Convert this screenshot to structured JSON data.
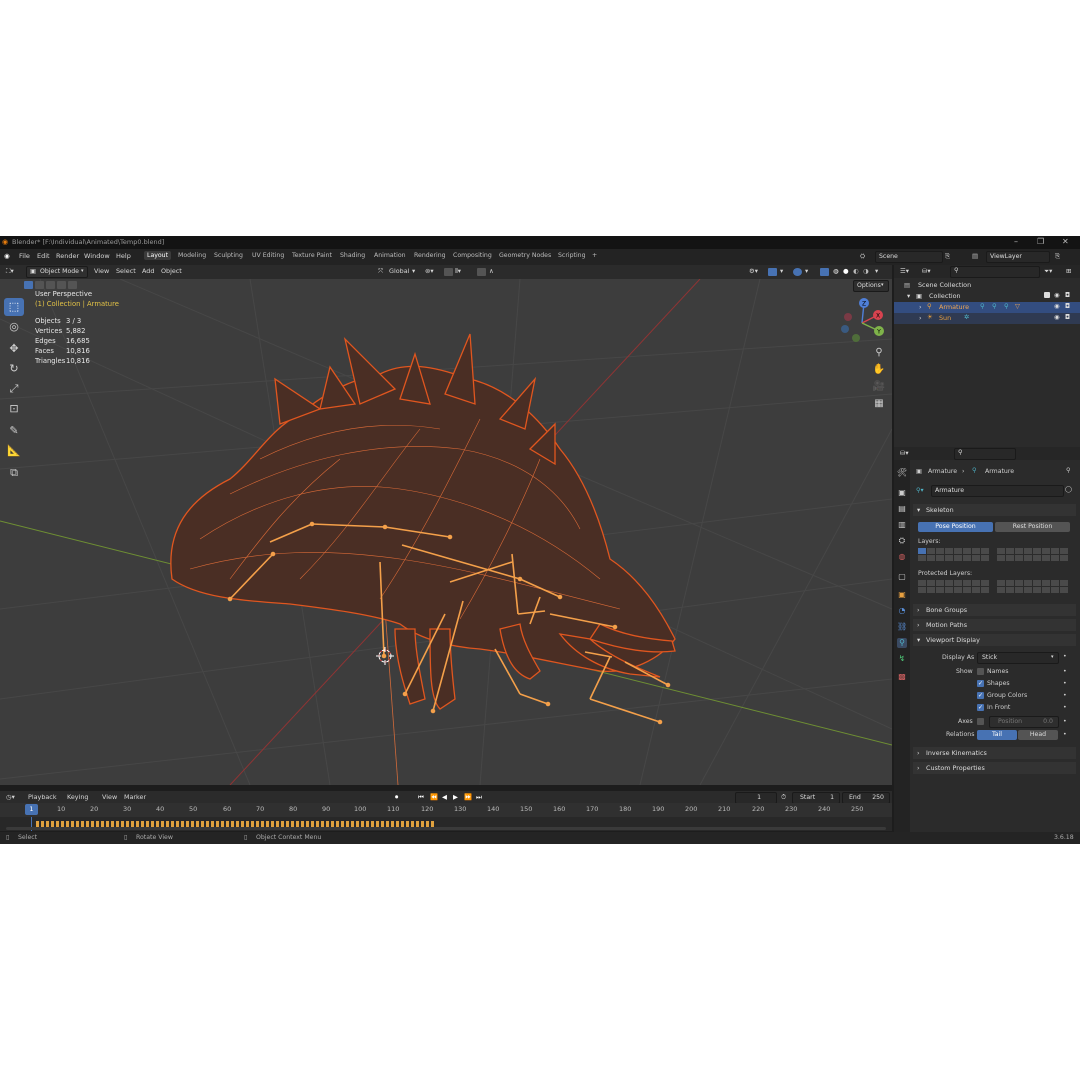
{
  "window": {
    "title": "Blender* [F:\\Individual\\Animated\\Temp0.blend]"
  },
  "menu": [
    "File",
    "Edit",
    "Render",
    "Window",
    "Help"
  ],
  "workspaces": [
    "Layout",
    "Modeling",
    "Sculpting",
    "UV Editing",
    "Texture Paint",
    "Shading",
    "Animation",
    "Rendering",
    "Compositing",
    "Geometry Nodes",
    "Scripting",
    "+"
  ],
  "active_workspace": "Layout",
  "scene_field": "Scene",
  "viewlayer_field": "ViewLayer",
  "viewport_header": {
    "mode": "Object Mode",
    "menus": [
      "View",
      "Select",
      "Add",
      "Object"
    ],
    "orientation": "Global",
    "options": "Options"
  },
  "viewport": {
    "perspective": "User Perspective",
    "context": "(1) Collection | Armature",
    "stats": [
      {
        "label": "Objects",
        "value": "3 / 3"
      },
      {
        "label": "Vertices",
        "value": "5,882"
      },
      {
        "label": "Edges",
        "value": "16,685"
      },
      {
        "label": "Faces",
        "value": "10,816"
      },
      {
        "label": "Triangles",
        "value": "10,816"
      }
    ],
    "gizmo_axes": [
      "Z",
      "Y",
      "X"
    ]
  },
  "colors": {
    "accent": "#4772b3",
    "wire": "#e0561f",
    "bone": "#f4a04a",
    "grid_x": "#a33a3a",
    "grid_y": "#7fa33a",
    "outliner_selected": "#334d80"
  },
  "outliner": {
    "root": "Scene Collection",
    "collection": "Collection",
    "items": [
      {
        "name": "Armature",
        "icon": "armature-icon",
        "selected": true
      },
      {
        "name": "Sun",
        "icon": "sun-icon",
        "selected": false
      }
    ]
  },
  "properties": {
    "breadcrumb": [
      "Armature",
      "Armature"
    ],
    "data_name": "Armature",
    "skeleton": {
      "title": "Skeleton",
      "pose_position": "Pose Position",
      "rest_position": "Rest Position",
      "layers": "Layers:",
      "protected_layers": "Protected Layers:"
    },
    "collapsed_panels": [
      "Bone Groups",
      "Motion Paths"
    ],
    "viewport_display": {
      "title": "Viewport Display",
      "display_as_label": "Display As",
      "display_as_value": "Stick",
      "show_label": "Show",
      "names": {
        "label": "Names",
        "checked": false
      },
      "shapes": {
        "label": "Shapes",
        "checked": true
      },
      "group_colors": {
        "label": "Group Colors",
        "checked": true
      },
      "in_front": {
        "label": "In Front",
        "checked": true
      },
      "axes_label": "Axes",
      "axes_position_label": "Position",
      "axes_position_value": "0.0",
      "relations_label": "Relations",
      "tail": "Tail",
      "head": "Head"
    },
    "bottom_panels": [
      "Inverse Kinematics",
      "Custom Properties"
    ]
  },
  "timeline": {
    "menus": [
      "Playback",
      "Keying",
      "View",
      "Marker"
    ],
    "current_frame": "1",
    "start_label": "Start",
    "start_value": "1",
    "end_label": "End",
    "end_value": "250",
    "ticks": [
      "10",
      "20",
      "30",
      "40",
      "50",
      "60",
      "70",
      "80",
      "90",
      "100",
      "110",
      "120",
      "130",
      "140",
      "150",
      "160",
      "170",
      "180",
      "190",
      "200",
      "210",
      "220",
      "230",
      "240",
      "250"
    ],
    "playhead": "1"
  },
  "statusbar": {
    "select": "Select",
    "rotate": "Rotate View",
    "context_menu": "Object Context Menu",
    "version": "3.6.18"
  }
}
